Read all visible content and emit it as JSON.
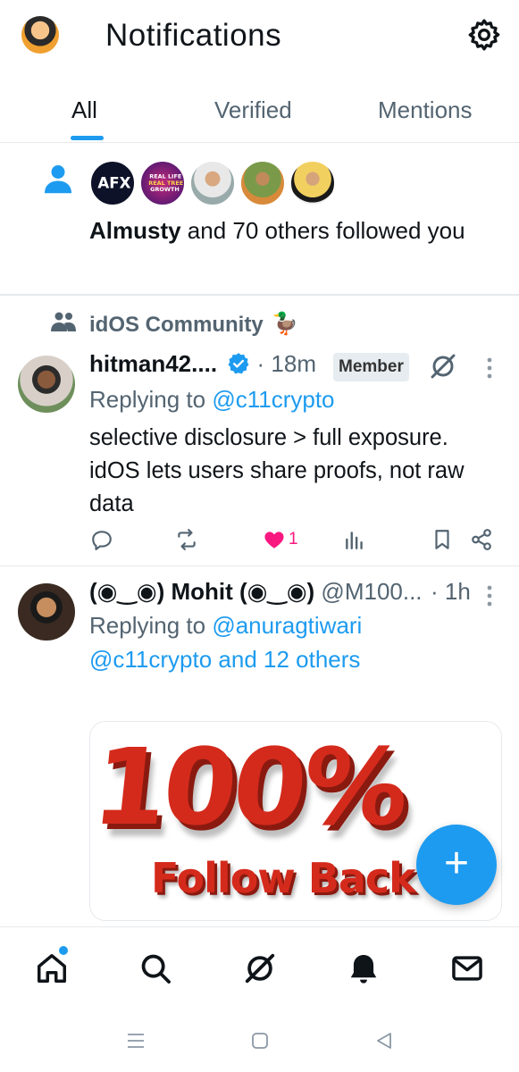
{
  "header": {
    "title": "Notifications",
    "avatar_icon": "profile-avatar",
    "settings_icon": "gear-icon"
  },
  "tabs": [
    {
      "label": "All",
      "active": true
    },
    {
      "label": "Verified",
      "active": false
    },
    {
      "label": "Mentions",
      "active": false
    }
  ],
  "follow_notification": {
    "icon": "person-icon",
    "name": "Almusty",
    "text": " and 70 others followed you",
    "avatars": [
      "#1a1f3a",
      "#3a1470",
      "#c9b08a",
      "#5a7a3a",
      "#e8d6a0"
    ]
  },
  "post1": {
    "community": "idOS Community",
    "community_emoji": "🦆",
    "author": "hitman42....",
    "time": "· 18m",
    "badge": "Member",
    "replying_prefix": "Replying to ",
    "replying_to": "@c11crypto",
    "text": "selective disclosure > full exposure. idOS lets users share proofs, not raw data",
    "like_count": "1"
  },
  "post2": {
    "author": "(◉‿◉) Mohit (◉‿◉)",
    "handle": " @M100...",
    "time": "· 1h",
    "replying_prefix": "Replying to ",
    "replying_line1": "@anuragtiwari",
    "replying_line2": "@c11crypto and 12 others",
    "media_big": "100%",
    "media_small": "Follow Back"
  },
  "fab": {
    "label": "+"
  },
  "colors": {
    "accent": "#1d9bf0",
    "like": "#f91880",
    "secondary_text": "#536471"
  }
}
